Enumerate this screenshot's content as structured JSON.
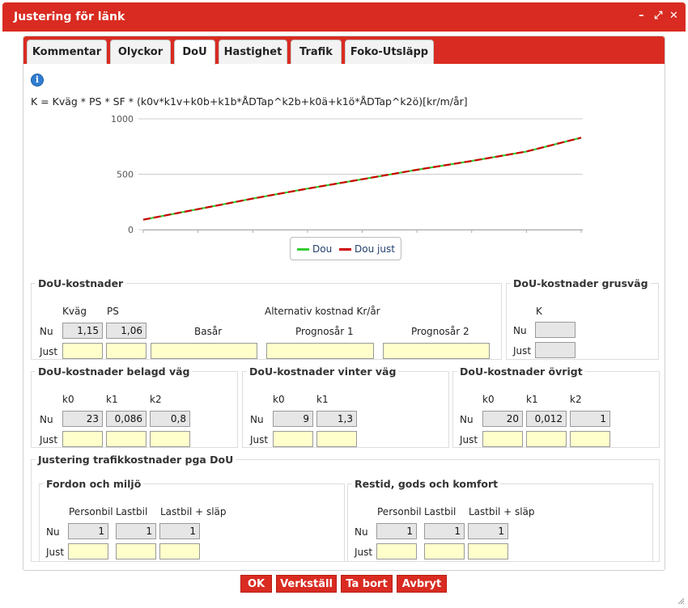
{
  "window": {
    "title": "Justering för länk",
    "minimize_glyph": "–",
    "restore_glyph": "⤢",
    "close_glyph": "✕"
  },
  "tabs": [
    "Kommentar",
    "Olyckor",
    "DoU",
    "Hastighet",
    "Trafik",
    "Foko-Utsläpp"
  ],
  "active_tab": "DoU",
  "info_glyph": "i",
  "formula": "K = Kväg * PS * SF * (k0v*k1v+k0b+k1b*ÅDTap^k2b+k0ä+k1ö*ÅDTap^k2ö)[kr/m/år]",
  "chart_data": {
    "type": "line",
    "ylim": [
      0,
      1000
    ],
    "yticks": [
      0,
      500,
      1000
    ],
    "ytick_labels": [
      "0",
      "500",
      "1000"
    ],
    "x": [
      0,
      1,
      2,
      3,
      4,
      5,
      6,
      7,
      8
    ],
    "series": [
      {
        "name": "Dou",
        "color": "#33cc33",
        "values": [
          90,
          185,
          280,
          370,
          455,
          540,
          620,
          705,
          830
        ]
      },
      {
        "name": "Dou just",
        "color": "#cc0000",
        "values": [
          90,
          185,
          280,
          370,
          455,
          540,
          620,
          705,
          830
        ]
      }
    ],
    "legend": "bottom-center"
  },
  "dou_kostnader": {
    "legend": "DoU-kostnader",
    "col_kvag": "Kväg",
    "col_ps": "PS",
    "alt_header": "Alternativ kostnad Kr/år",
    "basar": "Basår",
    "prog1": "Prognosår 1",
    "prog2": "Prognosår 2",
    "row_nu": "Nu",
    "row_just": "Just",
    "kvag_nu": "1,15",
    "ps_nu": "1,06"
  },
  "grusvag": {
    "legend": "DoU-kostnader grusväg",
    "col_k": "K",
    "row_nu": "Nu",
    "row_just": "Just"
  },
  "belagd": {
    "legend": "DoU-kostnader belagd väg",
    "cols": [
      "k0",
      "k1",
      "k2"
    ],
    "nu": [
      "23",
      "0,086",
      "0,8"
    ],
    "row_nu": "Nu",
    "row_just": "Just"
  },
  "vinter": {
    "legend": "DoU-kostnader vinter väg",
    "cols": [
      "k0",
      "k1"
    ],
    "nu": [
      "9",
      "1,3"
    ],
    "row_nu": "Nu",
    "row_just": "Just"
  },
  "ovrigt": {
    "legend": "DoU-kostnader övrigt",
    "cols": [
      "k0",
      "k1",
      "k2"
    ],
    "nu": [
      "20",
      "0,012",
      "1"
    ],
    "row_nu": "Nu",
    "row_just": "Just"
  },
  "justering": {
    "legend": "Justering trafikkostnader pga DoU",
    "fordon": {
      "legend": "Fordon och miljö",
      "cols": [
        "Personbil",
        "Lastbil",
        "Lastbil + släp"
      ],
      "nu": [
        "1",
        "1",
        "1"
      ],
      "row_nu": "Nu",
      "row_just": "Just"
    },
    "restid": {
      "legend": "Restid, gods och komfort",
      "cols": [
        "Personbil",
        "Lastbil",
        "Lastbil + släp"
      ],
      "nu": [
        "1",
        "1",
        "1"
      ],
      "row_nu": "Nu",
      "row_just": "Just"
    }
  },
  "buttons": {
    "ok": "OK",
    "verkstall": "Verkställ",
    "ta_bort": "Ta bort",
    "avbryt": "Avbryt"
  }
}
